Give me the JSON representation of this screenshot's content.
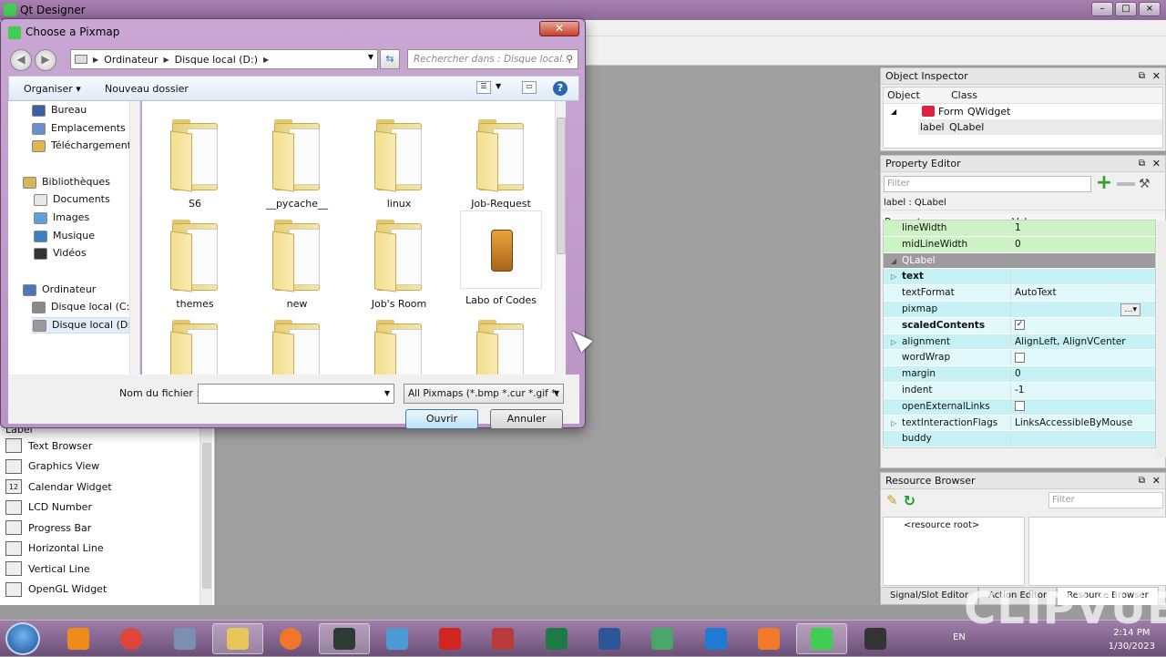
{
  "app": {
    "title": "Qt Designer"
  },
  "widget_box": {
    "partial_item": "Label",
    "items": [
      {
        "label": "Text Browser",
        "icon": "AI"
      },
      {
        "label": "Graphics View",
        "icon": "gv"
      },
      {
        "label": "Calendar Widget",
        "icon": "12"
      },
      {
        "label": "LCD Number",
        "icon": "lcd"
      },
      {
        "label": "Progress Bar",
        "icon": "pb"
      },
      {
        "label": "Horizontal Line",
        "icon": "hl"
      },
      {
        "label": "Vertical Line",
        "icon": "vl"
      },
      {
        "label": "OpenGL Widget",
        "icon": "gl"
      }
    ]
  },
  "object_inspector": {
    "title": "Object Inspector",
    "columns": [
      "Object",
      "Class"
    ],
    "rows": [
      {
        "object": "Form",
        "class": "QWidget"
      },
      {
        "object": "label",
        "class": "QLabel"
      }
    ]
  },
  "property_editor": {
    "title": "Property Editor",
    "filter_placeholder": "Filter",
    "object_label": "label : QLabel",
    "columns": [
      "Property",
      "Value"
    ],
    "rows": [
      {
        "name": "lineWidth",
        "value": "1",
        "style": "green"
      },
      {
        "name": "midLineWidth",
        "value": "0",
        "style": "green"
      },
      {
        "name": "QLabel",
        "value": "",
        "style": "grey"
      },
      {
        "name": "text",
        "value": "",
        "style": "cyan",
        "bold": true,
        "expand": true
      },
      {
        "name": "textFormat",
        "value": "AutoText",
        "style": "cyan2"
      },
      {
        "name": "pixmap",
        "value": "",
        "style": "cyan"
      },
      {
        "name": "scaledContents",
        "value": "",
        "style": "cyan2",
        "bold": true,
        "checkbox": "checked"
      },
      {
        "name": "alignment",
        "value": "AlignLeft, AlignVCenter",
        "style": "cyan",
        "expand": true
      },
      {
        "name": "wordWrap",
        "value": "",
        "style": "cyan2",
        "checkbox": "unchecked"
      },
      {
        "name": "margin",
        "value": "0",
        "style": "cyan"
      },
      {
        "name": "indent",
        "value": "-1",
        "style": "cyan2"
      },
      {
        "name": "openExternalLinks",
        "value": "",
        "style": "cyan",
        "checkbox": "unchecked"
      },
      {
        "name": "textInteractionFlags",
        "value": "LinksAccessibleByMouse",
        "style": "cyan2",
        "expand": true
      },
      {
        "name": "buddy",
        "value": "",
        "style": "cyan"
      }
    ]
  },
  "resource_browser": {
    "title": "Resource Browser",
    "filter_placeholder": "Filter",
    "root_label": "<resource root>"
  },
  "dock_tabs": [
    "Signal/Slot Editor",
    "Action Editor",
    "Resource Browser"
  ],
  "dialog": {
    "title": "Choose a Pixmap",
    "breadcrumb": [
      "Ordinateur",
      "Disque local (D:)"
    ],
    "search_placeholder": "Rechercher dans : Disque local...",
    "toolbar": {
      "organize": "Organiser",
      "new_folder": "Nouveau dossier"
    },
    "nav": [
      {
        "label": "Bureau",
        "icon_color": "#3a5fa8"
      },
      {
        "label": "Emplacements ré",
        "icon_color": "#6b8fc8"
      },
      {
        "label": "Téléchargements",
        "icon_color": "#e0b64c"
      },
      {
        "label": "Bibliothèques",
        "icon_color": "#d9b55a"
      },
      {
        "label": "Documents",
        "icon_color": "#e7e7e7"
      },
      {
        "label": "Images",
        "icon_color": "#5ea0d8"
      },
      {
        "label": "Musique",
        "icon_color": "#3a7fc6"
      },
      {
        "label": "Vidéos",
        "icon_color": "#333333"
      },
      {
        "label": "Ordinateur",
        "icon_color": "#4a78b8"
      },
      {
        "label": "Disque local (C:)",
        "icon_color": "#8a8a8a"
      },
      {
        "label": "Disque local (D:)",
        "icon_color": "#9a9a9a"
      }
    ],
    "files": [
      {
        "label": "S6"
      },
      {
        "label": "__pycache__"
      },
      {
        "label": "linux"
      },
      {
        "label": "Job-Request"
      },
      {
        "label": "themes"
      },
      {
        "label": "new"
      },
      {
        "label": "Job's Room"
      },
      {
        "label": "Labo of Codes"
      },
      {
        "label": ""
      },
      {
        "label": ""
      },
      {
        "label": ""
      },
      {
        "label": ""
      }
    ],
    "filename_label": "Nom du fichier :",
    "filename_value": "",
    "filetype": "All Pixmaps (*.bmp *.cur *.gif *.",
    "open_button": "Ouvrir",
    "cancel_button": "Annuler"
  },
  "taskbar": {
    "apps": [
      "vlc",
      "chrome",
      "paint",
      "explorer",
      "firefox",
      "qt-creator",
      "paint-net",
      "acrobat",
      "access",
      "excel",
      "word",
      "box",
      "vscode",
      "xampp",
      "qt-designer",
      "terminal"
    ],
    "lang": "EN",
    "time": "2:14 PM",
    "date": "1/30/2023"
  },
  "watermark": "CLIPVUE"
}
